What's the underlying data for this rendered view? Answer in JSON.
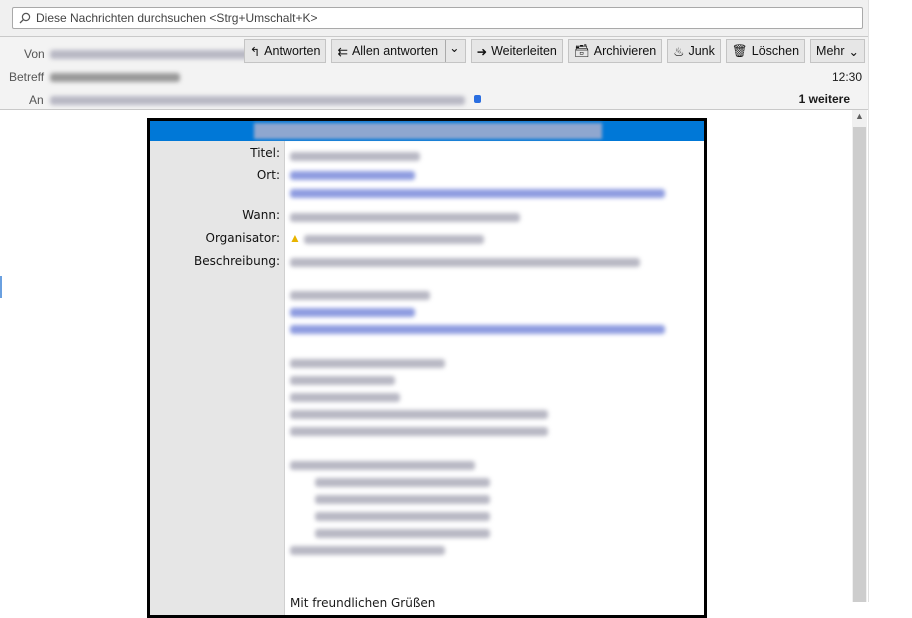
{
  "search": {
    "placeholder": "Diese Nachrichten durchsuchen <Strg+Umschalt+K>"
  },
  "header": {
    "from_label": "Von",
    "subject_label": "Betreff",
    "to_label": "An",
    "time": "12:30",
    "more_recipients": "1 weitere"
  },
  "toolbar": {
    "reply": "Antworten",
    "reply_all": "Allen antworten",
    "forward": "Weiterleiten",
    "archive": "Archivieren",
    "junk": "Junk",
    "delete": "Löschen",
    "more": "Mehr"
  },
  "invite": {
    "labels": {
      "title": "Titel:",
      "location": "Ort:",
      "when": "Wann:",
      "organizer": "Organisator:",
      "description": "Beschreibung:"
    },
    "closing": "Mit freundlichen Grüßen"
  },
  "colors": {
    "accent": "#0078d7",
    "link_blur": "#7b8fe0"
  }
}
